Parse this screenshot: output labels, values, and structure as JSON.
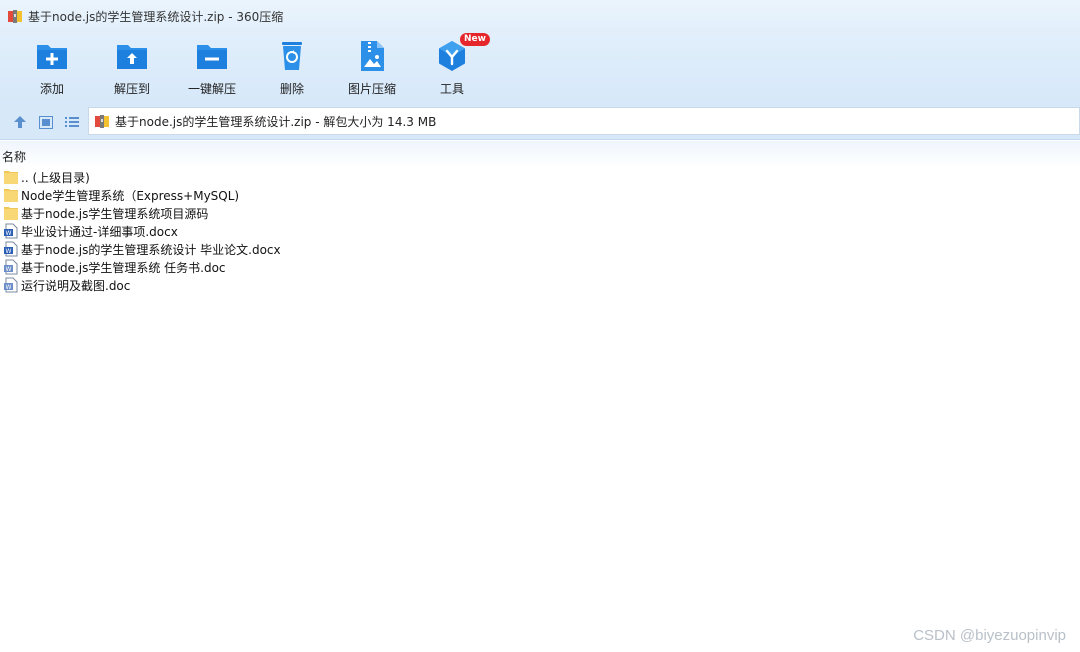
{
  "window": {
    "title": "基于node.js的学生管理系统设计.zip - 360压缩"
  },
  "toolbar": {
    "buttons": [
      {
        "label": "添加",
        "icon": "add-folder-icon"
      },
      {
        "label": "解压到",
        "icon": "extract-to-icon"
      },
      {
        "label": "一键解压",
        "icon": "one-click-extract-icon"
      },
      {
        "label": "删除",
        "icon": "recycle-bin-icon"
      },
      {
        "label": "图片压缩",
        "icon": "image-compress-icon"
      },
      {
        "label": "工具",
        "icon": "tools-icon",
        "badge": "New"
      }
    ]
  },
  "nav": {
    "up_icon": "arrow-up-icon",
    "thumbnail_view_icon": "thumbnail-view-icon",
    "list_view_icon": "list-view-icon",
    "address_text": "基于node.js的学生管理系统设计.zip - 解包大小为 14.3 MB"
  },
  "list": {
    "column_name": "名称",
    "rows": [
      {
        "name": ".. (上级目录)",
        "type": "folder"
      },
      {
        "name": "Node学生管理系统（Express+MySQL)",
        "type": "folder"
      },
      {
        "name": "基于node.js学生管理系统项目源码",
        "type": "folder"
      },
      {
        "name": "毕业设计通过-详细事项.docx",
        "type": "word"
      },
      {
        "name": "基于node.js的学生管理系统设计 毕业论文.docx",
        "type": "word"
      },
      {
        "name": "基于node.js学生管理系统 任务书.doc",
        "type": "word-doc"
      },
      {
        "name": "运行说明及截图.doc",
        "type": "word-doc"
      }
    ]
  },
  "watermark": "CSDN @biyezuopinvip",
  "colors": {
    "accent": "#1e8be6",
    "toolbar_bg": "#dcebfa",
    "folder": "#f8d775",
    "badge": "#e5262b"
  }
}
